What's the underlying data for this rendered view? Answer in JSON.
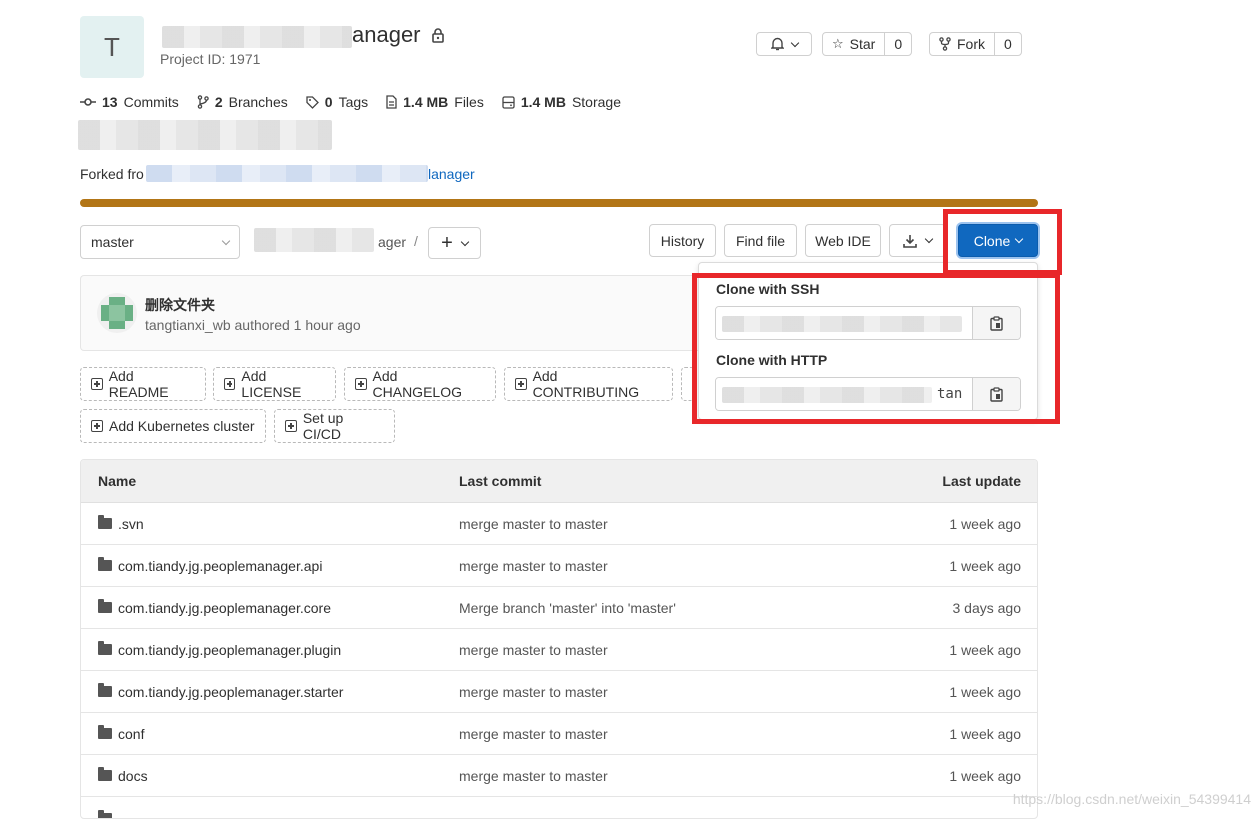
{
  "project": {
    "avatar_letter": "T",
    "title_visible": "anager",
    "project_id": "Project ID: 1971"
  },
  "header_actions": {
    "star_label": "Star",
    "star_count": "0",
    "fork_label": "Fork",
    "fork_count": "0"
  },
  "stats": {
    "commits_count": "13",
    "commits_label": "Commits",
    "branches_count": "2",
    "branches_label": "Branches",
    "tags_count": "0",
    "tags_label": "Tags",
    "files_size": "1.4 MB",
    "files_label": "Files",
    "storage_size": "1.4 MB",
    "storage_label": "Storage"
  },
  "forked": {
    "prefix": "Forked fro",
    "link_suffix": "lanager"
  },
  "toolbar": {
    "branch": "master",
    "path_suffix": "ager",
    "separator": "/",
    "history": "History",
    "find_file": "Find file",
    "web_ide": "Web IDE",
    "clone": "Clone"
  },
  "last_commit": {
    "message": "删除文件夹",
    "author_line": "tangtianxi_wb authored 1 hour ago"
  },
  "quick_actions": [
    "Add README",
    "Add LICENSE",
    "Add CHANGELOG",
    "Add CONTRIBUTING",
    "Add Kubernetes cluster",
    "Set up CI/CD"
  ],
  "clone_dropdown": {
    "ssh_label": "Clone with SSH",
    "http_label": "Clone with HTTP",
    "http_value_tail": "tan"
  },
  "table": {
    "headers": [
      "Name",
      "Last commit",
      "Last update"
    ],
    "rows": [
      {
        "name": ".svn",
        "commit": "merge master to master",
        "updated": "1 week ago"
      },
      {
        "name": "com.tiandy.jg.peoplemanager.api",
        "commit": "merge master to master",
        "updated": "1 week ago"
      },
      {
        "name": "com.tiandy.jg.peoplemanager.core",
        "commit": "Merge branch 'master' into 'master'",
        "updated": "3 days ago"
      },
      {
        "name": "com.tiandy.jg.peoplemanager.plugin",
        "commit": "merge master to master",
        "updated": "1 week ago"
      },
      {
        "name": "com.tiandy.jg.peoplemanager.starter",
        "commit": "merge master to master",
        "updated": "1 week ago"
      },
      {
        "name": "conf",
        "commit": "merge master to master",
        "updated": "1 week ago"
      },
      {
        "name": "docs",
        "commit": "merge master to master",
        "updated": "1 week ago"
      }
    ]
  },
  "watermark": "https://blog.csdn.net/weixin_54399414",
  "colors": {
    "accent_blue": "#1068bf",
    "language_bar": "#b27516",
    "highlight_red": "#e8272a"
  }
}
